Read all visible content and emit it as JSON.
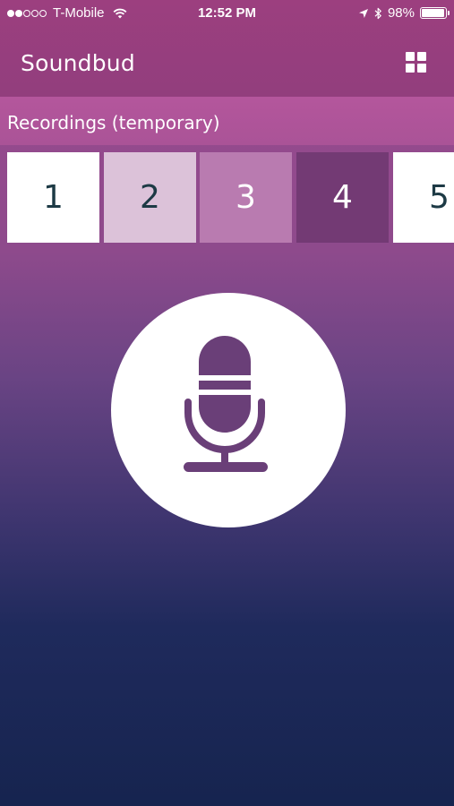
{
  "status_bar": {
    "signal_dots": [
      true,
      true,
      false,
      false,
      false
    ],
    "carrier": "T-Mobile",
    "time": "12:52 PM",
    "battery_percent": "98%",
    "battery_level": 0.98,
    "icons": [
      "wifi-icon",
      "location-arrow-icon",
      "bluetooth-icon",
      "battery-icon"
    ]
  },
  "header": {
    "title": "Soundbud",
    "grid_icon": "grid-icon"
  },
  "recordings": {
    "label": "Recordings (temporary)",
    "slots": [
      {
        "label": "1",
        "bg": "#ffffff",
        "fg": "#1d3a45"
      },
      {
        "label": "2",
        "bg": "#dcc2d9",
        "fg": "#1d3a45"
      },
      {
        "label": "3",
        "bg": "#b97bb0",
        "fg": "#ffffff"
      },
      {
        "label": "4",
        "bg": "#733a74",
        "fg": "#ffffff"
      },
      {
        "label": "5",
        "bg": "#ffffff",
        "fg": "#1d3a45"
      }
    ]
  },
  "record_button": {
    "icon": "microphone-icon",
    "icon_color": "#6a3f78"
  },
  "colors": {
    "header": "#9c3f7f",
    "recordings_bar": "#b4569c",
    "background_bottom": "#16244f"
  }
}
